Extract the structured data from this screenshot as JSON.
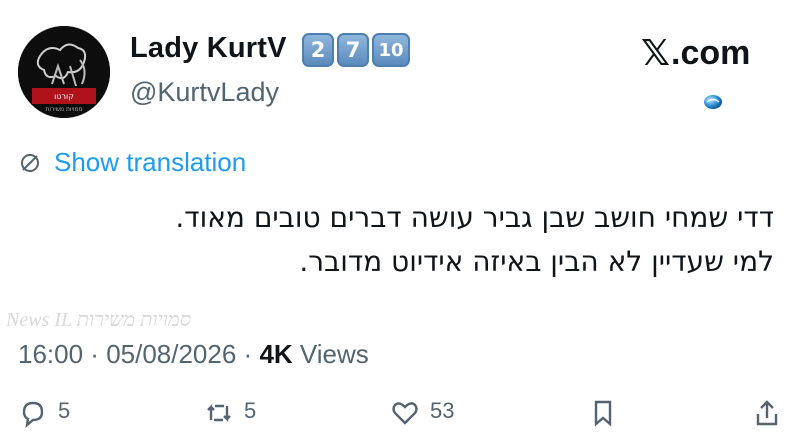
{
  "author": {
    "display_name": "Lady KurtV",
    "badges": [
      "2",
      "7",
      "10"
    ],
    "handle": "@KurtvLady",
    "avatar": {
      "caption": "קורטו",
      "subcaption": "סמויות משירות"
    }
  },
  "brand": {
    "x_glyph": "𝕏",
    "suffix": ".com"
  },
  "translate": {
    "label": "Show translation",
    "icon": "translate-icon"
  },
  "tweet": {
    "lines": [
      "דדי שמחי חושב שבן גביר עושה דברים טובים מאוד.",
      "למי שעדיין לא הבין באיזה אידיוט מדובר."
    ]
  },
  "watermark": {
    "text": "News IL  סמויות משירות"
  },
  "meta": {
    "time": "16:00",
    "sep1": " · ",
    "date": "05/08/2026",
    "sep2": " · ",
    "views_count": "4K",
    "views_label": " Views"
  },
  "actions": [
    {
      "icon": "reply-icon",
      "count": "5"
    },
    {
      "icon": "retweet-icon",
      "count": "5"
    },
    {
      "icon": "heart-icon",
      "count": "53"
    },
    {
      "icon": "bookmark-icon",
      "count": ""
    },
    {
      "icon": "share-icon",
      "count": ""
    }
  ],
  "colors": {
    "link": "#1d9bf0",
    "secondary": "#536471",
    "text": "#0f1419",
    "badge": "#5b8bbd"
  }
}
